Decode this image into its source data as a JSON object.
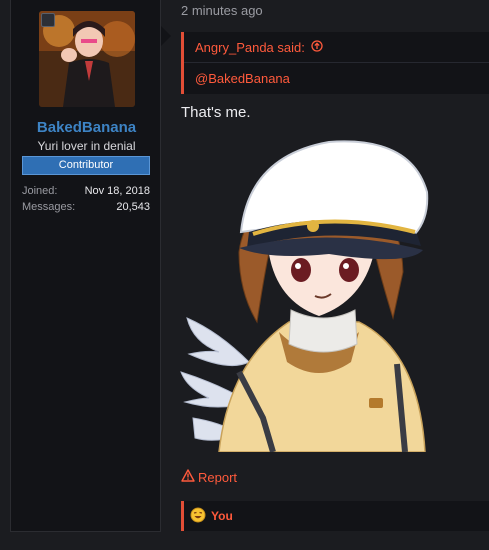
{
  "user": {
    "name": "BakedBanana",
    "title": "Yuri lover in denial",
    "banner": "Contributor",
    "stats": [
      {
        "label": "Joined:",
        "value": "Nov 18, 2018"
      },
      {
        "label": "Messages:",
        "value": "20,543"
      }
    ]
  },
  "post": {
    "timestamp": "2 minutes ago",
    "quote": {
      "author_line": "Angry_Panda said:",
      "body": "@BakedBanana"
    },
    "text": "That's me.",
    "report_label": "Report",
    "reaction_user": "You"
  },
  "colors": {
    "accent": "#ff5a3c",
    "username": "#3d83c4",
    "banner": "#2f6fb4",
    "background": "#1b1c20",
    "panel": "#121317"
  }
}
